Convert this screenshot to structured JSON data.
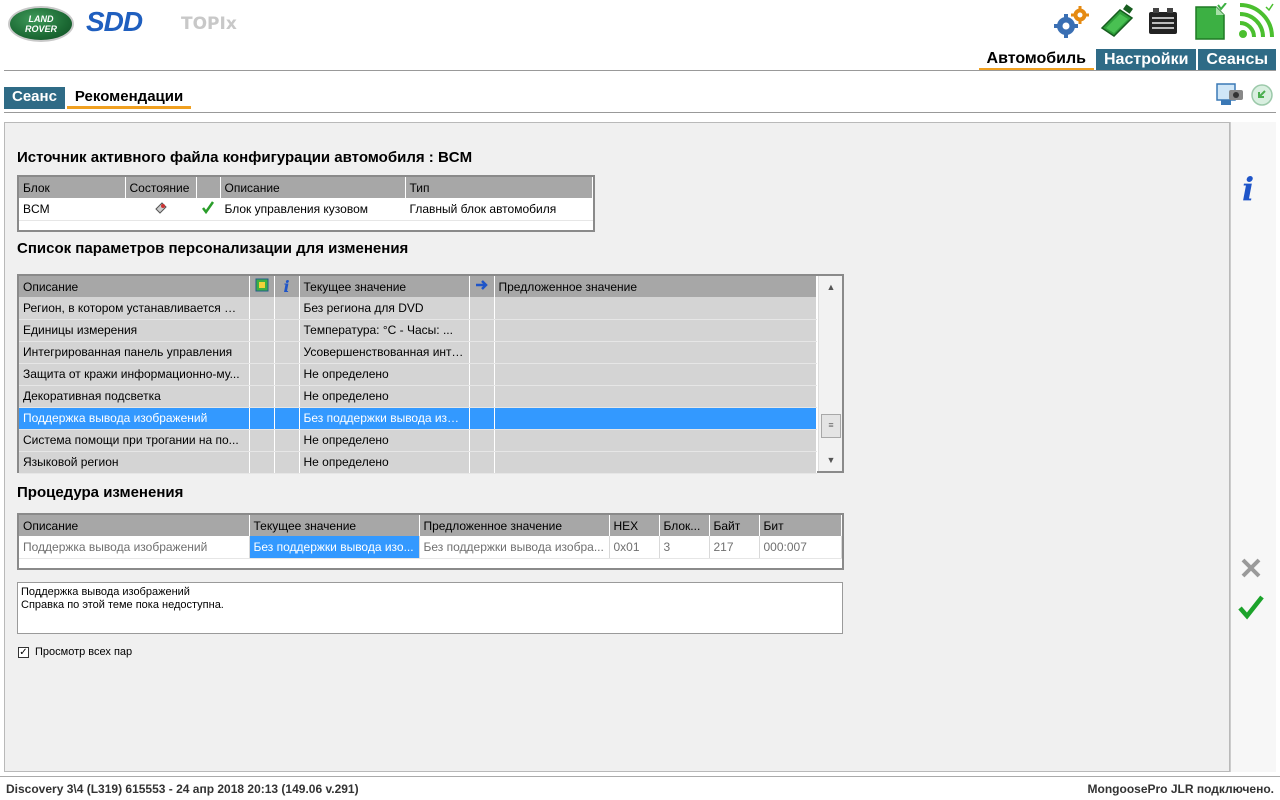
{
  "header": {
    "logo_line1": "LAND",
    "logo_line2": "ROVER",
    "brand": "SDD",
    "product": "TOPIx",
    "icons": [
      "settings-gears-icon",
      "vci-interface-icon",
      "battery-icon",
      "green-document-icon",
      "wireless-signal-icon"
    ]
  },
  "main_tabs": [
    {
      "label": "Автомобиль",
      "active": true
    },
    {
      "label": "Настройки",
      "active": false
    },
    {
      "label": "Сеансы",
      "active": false
    }
  ],
  "sub_tabs": [
    {
      "label": "Сеанс",
      "active": false
    },
    {
      "label": "Рекомендации",
      "active": true
    }
  ],
  "config_source": {
    "title": "Источник активного файла конфигурации автомобиля : BCM",
    "columns": [
      "Блок",
      "Состояние",
      "",
      "Описание",
      "Тип"
    ],
    "rows": [
      {
        "block": "BCM",
        "state_icon": "module-icon",
        "check_icon": "green-check-icon",
        "description": "Блок управления кузовом",
        "type": "Главный блок автомобиля"
      }
    ]
  },
  "params": {
    "title": "Список параметров персонализации для изменения",
    "columns": [
      "Описание",
      "",
      "",
      "Текущее значение",
      "",
      "Предложенное значение"
    ],
    "header_icons": [
      "module-config-icon",
      "info-icon",
      "arrow-right-icon"
    ],
    "rows": [
      {
        "description": "Регион, в котором устанавливается DVD",
        "current": "Без региона для DVD",
        "proposed": ""
      },
      {
        "description": "Единицы измерения",
        "current": "Температура:  °C  -  Часы: ...",
        "proposed": ""
      },
      {
        "description": "Интегрированная панель управления",
        "current": "Усовершенствованная инте...",
        "proposed": ""
      },
      {
        "description": "Защита от кражи информационно-му...",
        "current": "Не определено",
        "proposed": ""
      },
      {
        "description": "Декоративная подсветка",
        "current": "Не определено",
        "proposed": ""
      },
      {
        "description": "Поддержка вывода изображений",
        "current": "Без поддержки вывода изоб...",
        "proposed": "",
        "selected": true
      },
      {
        "description": "Система помощи при трогании на по...",
        "current": "Не определено",
        "proposed": ""
      },
      {
        "description": "Языковой регион",
        "current": "Не определено",
        "proposed": ""
      }
    ]
  },
  "procedure": {
    "title": "Процедура изменения",
    "columns": [
      "Описание",
      "Текущее значение",
      "Предложенное значение",
      "HEX",
      "Блок...",
      "Байт",
      "Бит"
    ],
    "rows": [
      {
        "description": "Поддержка вывода изображений",
        "current": "Без поддержки вывода изо...",
        "proposed": "Без поддержки вывода изобра...",
        "hex": "0x01",
        "block": "3",
        "byte": "217",
        "bit": "000:007"
      }
    ]
  },
  "help": {
    "line1": "Поддержка вывода изображений",
    "line2": "Справка по этой теме пока недоступна."
  },
  "view_all": {
    "label": "Просмотр всех пар",
    "checked": true
  },
  "side_buttons": [
    "info-icon",
    "cancel-x-icon",
    "confirm-check-icon"
  ],
  "footer": {
    "vehicle": "Discovery 3\\4 (L319) 615553 - 24 апр 2018 20:13 (149.06 v.291)",
    "status": "MongoosePro JLR подключено."
  }
}
